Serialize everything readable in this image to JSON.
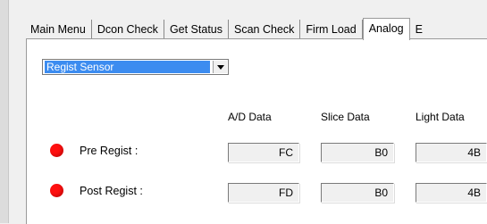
{
  "tabs": [
    "Main Menu",
    "Dcon Check",
    "Get Status",
    "Scan Check",
    "Firm Load",
    "Analog",
    "E"
  ],
  "active_tab_index": 5,
  "dropdown": {
    "selected": "Regist Sensor"
  },
  "columns": {
    "ad": "A/D Data",
    "slice": "Slice Data",
    "light": "Light Data"
  },
  "rows": [
    {
      "label": "Pre Regist :",
      "ad": "FC",
      "slice": "B0",
      "light": "4B",
      "indicator_color": "#ff1010"
    },
    {
      "label": "Post Regist :",
      "ad": "FD",
      "slice": "B0",
      "light": "4B",
      "indicator_color": "#ff1010"
    }
  ],
  "colors": {
    "selection": "#3c8cf0",
    "panel": "#ffffff",
    "window": "#f0f0f0"
  }
}
